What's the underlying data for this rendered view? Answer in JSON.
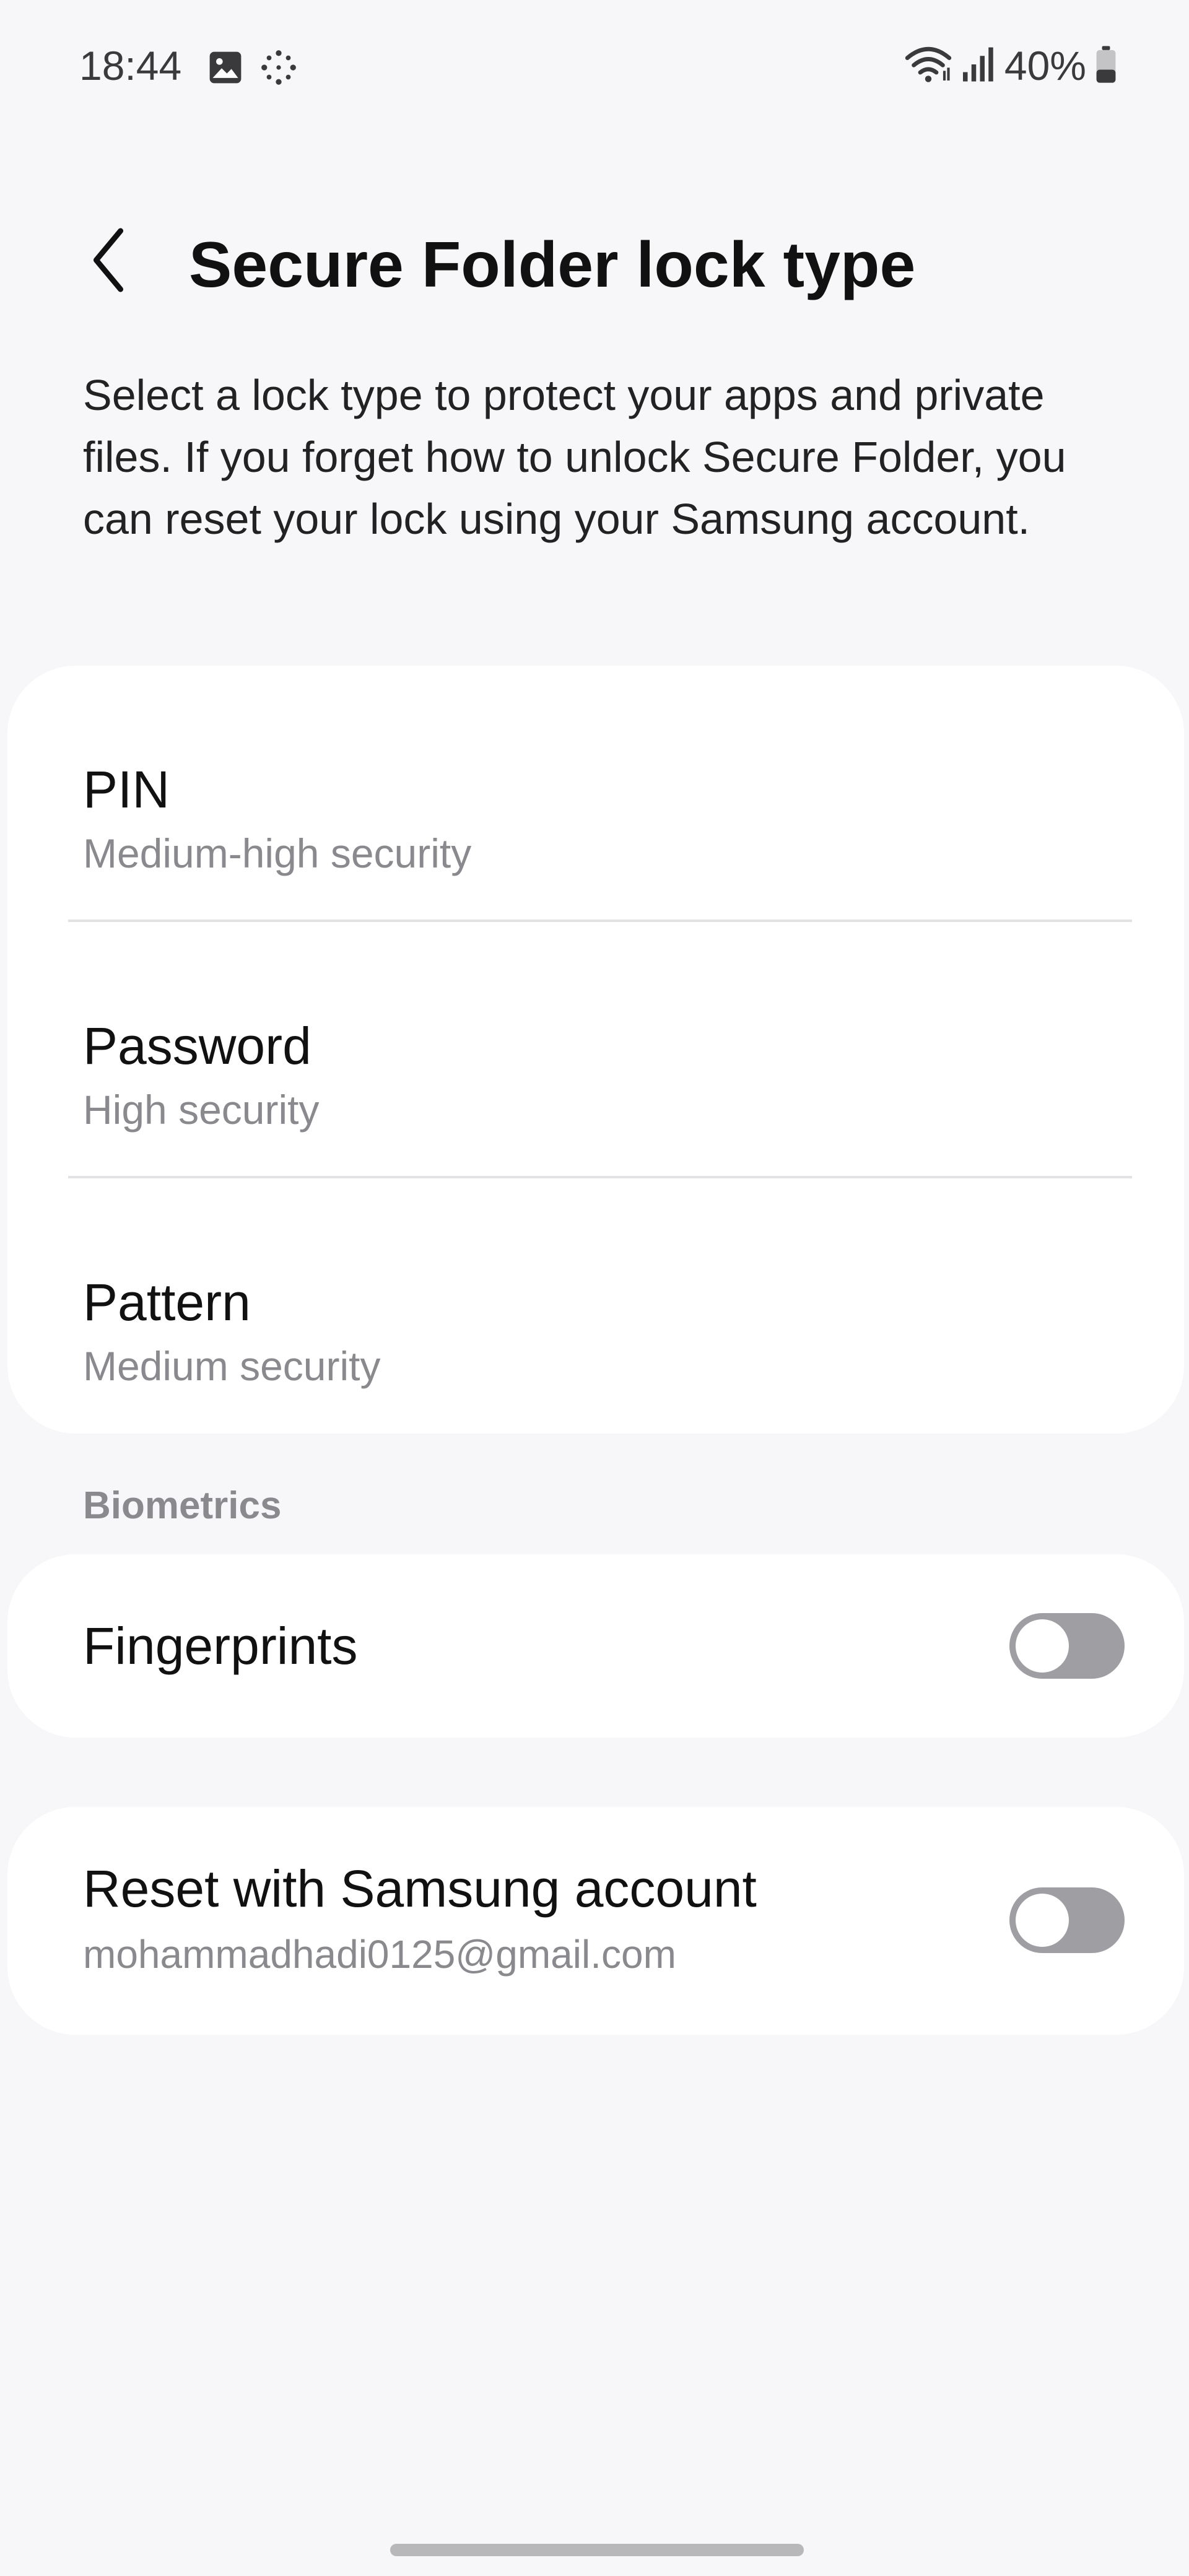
{
  "status_bar": {
    "time": "18:44",
    "left_icons": [
      "gallery-icon",
      "sparkle-dots-icon"
    ],
    "right_icons": [
      "wifi-icon",
      "cellular-signal-icon",
      "battery-icon"
    ],
    "battery_text": "40%",
    "battery_level": 0.4
  },
  "header": {
    "title": "Secure Folder lock type",
    "back_icon": "chevron-left-icon"
  },
  "description": "Select a lock type to protect your apps and private files. If you forget how to unlock Secure Folder, you can reset your lock using your Samsung account.",
  "lock_types": [
    {
      "title": "PIN",
      "subtitle": "Medium-high security"
    },
    {
      "title": "Password",
      "subtitle": "High security"
    },
    {
      "title": "Pattern",
      "subtitle": "Medium security"
    }
  ],
  "biometrics": {
    "section_label": "Biometrics",
    "fingerprints_label": "Fingerprints",
    "fingerprints_enabled": false
  },
  "reset": {
    "title": "Reset with Samsung account",
    "account": "mohammadhadi0125@gmail.com",
    "enabled": false
  },
  "colors": {
    "background": "#f7f7f9",
    "card": "#ffffff",
    "toggle_off": "#9e9ea3",
    "secondary_text": "#8a8a8e"
  }
}
